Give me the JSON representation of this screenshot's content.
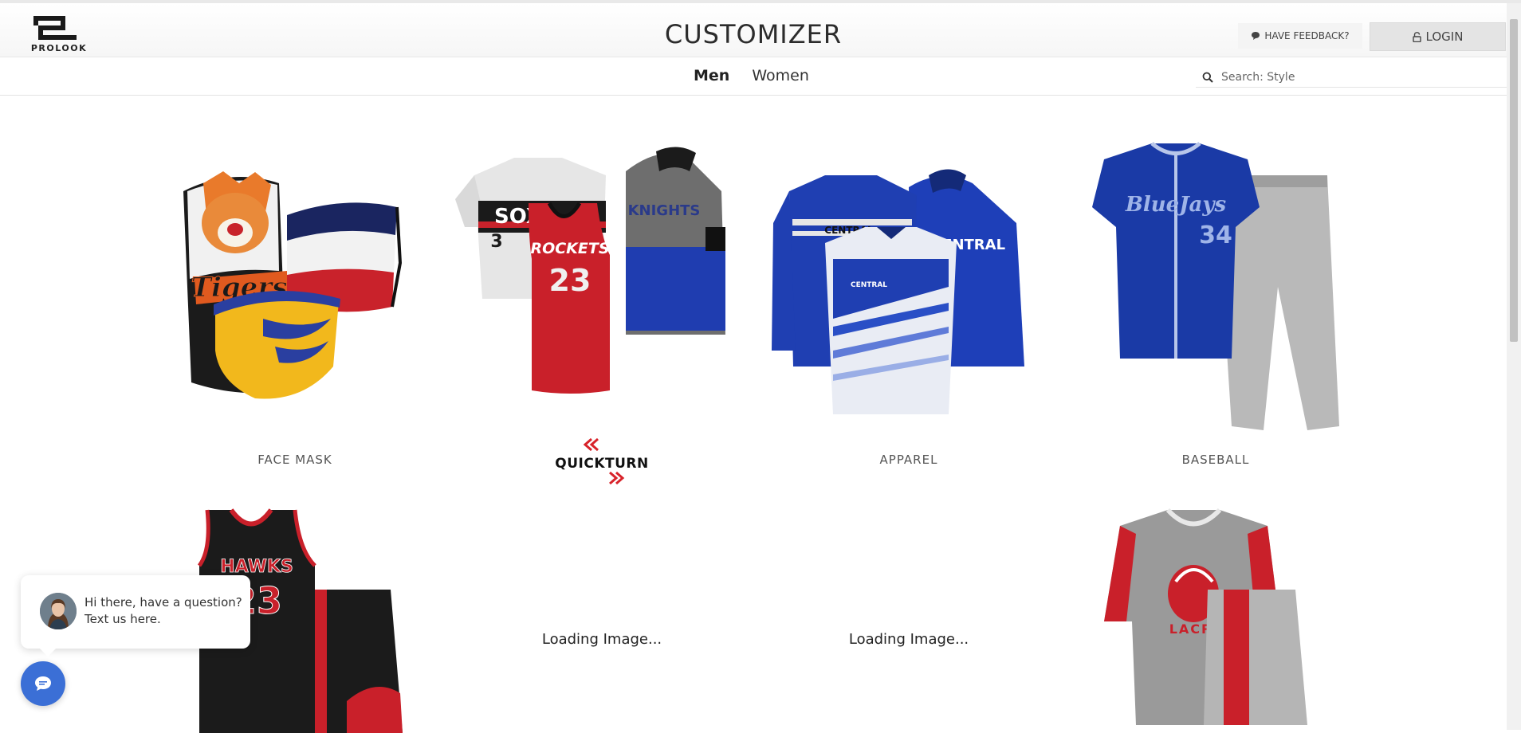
{
  "header": {
    "logo_text": "PROLOOK",
    "title": "CUSTOMIZER",
    "feedback_label": "HAVE FEEDBACK?",
    "login_label": "LOGIN"
  },
  "nav": {
    "tabs": [
      {
        "label": "Men",
        "active": true
      },
      {
        "label": "Women",
        "active": false
      }
    ],
    "search_placeholder": "Search: Style"
  },
  "categories": {
    "row1": [
      {
        "label": "FACE MASK"
      },
      {
        "label": "QUICKTURN",
        "art_text": [
          "SOX",
          "3",
          "ROCKETS",
          "23",
          "KNIGHTS"
        ]
      },
      {
        "label": "APPAREL",
        "art_text": [
          "CENTRAL",
          "CENTRAL",
          "CENTRAL"
        ]
      },
      {
        "label": "BASEBALL",
        "art_text": [
          "BlueJays",
          "34"
        ]
      }
    ],
    "row2": [
      {
        "label": "",
        "art_text": [
          "HAWKS",
          "23"
        ]
      },
      {
        "loading": "Loading Image..."
      },
      {
        "loading": "Loading Image..."
      },
      {
        "label": "",
        "art_text": [
          "LACROSS"
        ]
      }
    ],
    "face_mask_art_text": "Tigers"
  },
  "chat": {
    "message": "Hi there, have a question? Text us here."
  },
  "colors": {
    "accent_red": "#d8232a",
    "royal_blue": "#1f3fa3",
    "chat_blue": "#3b6fd6"
  }
}
